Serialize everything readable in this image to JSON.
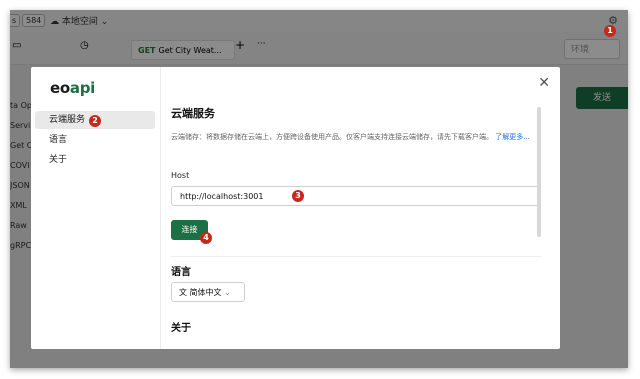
{
  "app": {
    "topbar": {
      "badge_a": "s",
      "badge_b": "584",
      "workspace": "本地空间"
    },
    "request_tab": {
      "method": "GET",
      "title": "Get City Weat..."
    },
    "env_placeholder": "环境",
    "send_label": "发送",
    "left_items": [
      "ta Ope",
      "Servi",
      "Get C",
      "COVI",
      "JSON",
      "XML",
      "Raw",
      "gRPC"
    ]
  },
  "modal": {
    "logo": {
      "eo": "eo",
      "api": "api"
    },
    "nav": [
      {
        "label": "云端服务"
      },
      {
        "label": "语言"
      },
      {
        "label": "关于"
      }
    ],
    "cloud_title": "云端服务",
    "cloud_desc": "云端储存：将数据存储在云端上，方便跨设备使用产品。仅客户端支持连接云端储存，请先下载客户端。",
    "cloud_desc_link": "了解更多...",
    "host_label": "Host",
    "host_value": "http://localhost:3001",
    "connect_label": "连接",
    "language_title": "语言",
    "language_value": "简体中文",
    "about_title": "关于"
  },
  "markers": [
    "1",
    "2",
    "3",
    "4"
  ],
  "colors": {
    "primary": "#1d7045",
    "marker": "#c6281d",
    "link": "#1a73e8"
  }
}
